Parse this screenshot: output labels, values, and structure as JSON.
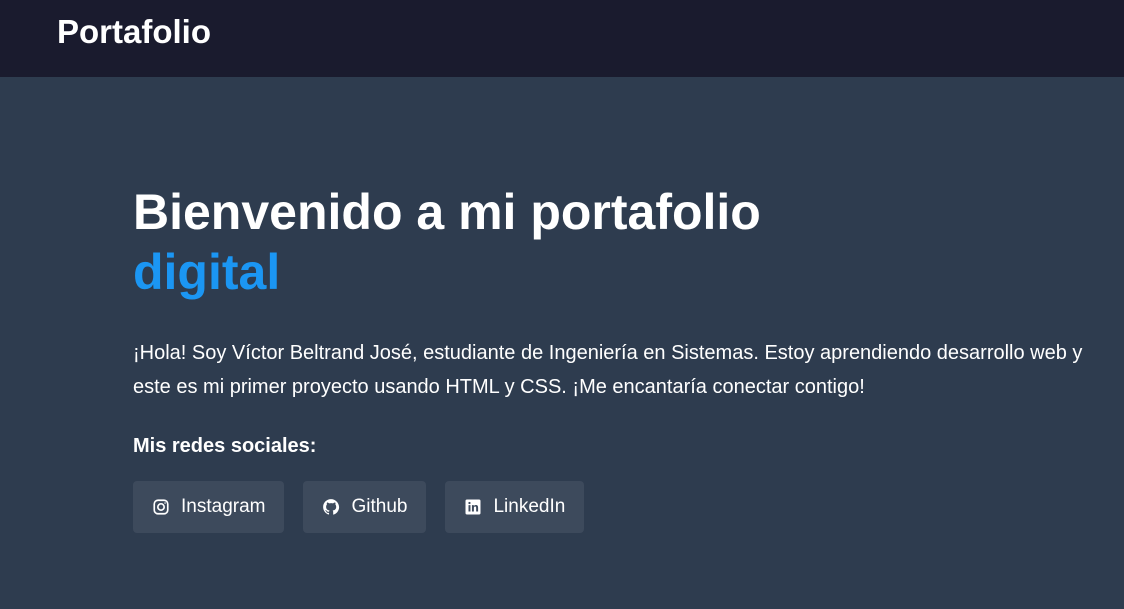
{
  "header": {
    "brand": "Portafolio"
  },
  "hero": {
    "title_line1": "Bienvenido a mi portafolio",
    "title_accent": "digital",
    "intro": "¡Hola! Soy Víctor Beltrand José, estudiante de Ingeniería en Sistemas. Estoy aprendiendo desarrollo web y este es mi primer proyecto usando HTML y CSS. ¡Me encantaría conectar contigo!"
  },
  "social": {
    "heading": "Mis redes sociales:",
    "buttons": [
      {
        "label": "Instagram",
        "icon": "instagram-icon"
      },
      {
        "label": "Github",
        "icon": "github-icon"
      },
      {
        "label": "LinkedIn",
        "icon": "linkedin-icon"
      }
    ]
  },
  "colors": {
    "header_bg": "#1a1b2e",
    "page_bg": "#2e3c4f",
    "accent": "#1b96f3",
    "button_bg": "#3d4a5c",
    "text": "#ffffff"
  }
}
